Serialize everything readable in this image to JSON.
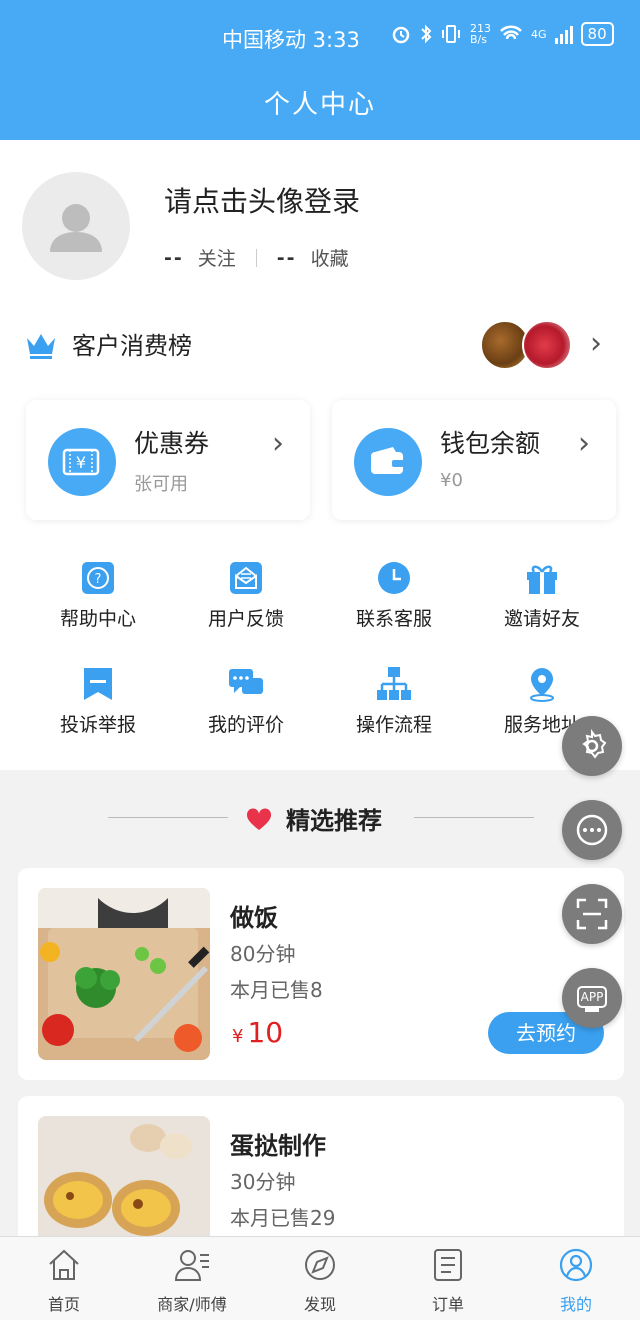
{
  "status_bar": {
    "carrier_time": "中国移动 3:33",
    "net_speed_top": "213",
    "net_speed_bottom": "B/s",
    "signal": "4G",
    "battery": "80"
  },
  "header": {
    "title": "个人中心"
  },
  "profile": {
    "login_prompt": "请点击头像登录",
    "follow_count": "--",
    "follow_label": "关注",
    "fav_count": "--",
    "fav_label": "收藏"
  },
  "ranking": {
    "label": "客户消费榜"
  },
  "cards": [
    {
      "title": "优惠券",
      "subtitle": "张可用",
      "icon": "coupon-icon"
    },
    {
      "title": "钱包余额",
      "subtitle": "¥0",
      "icon": "wallet-icon"
    }
  ],
  "menu": [
    {
      "label": "帮助中心",
      "icon": "help-icon"
    },
    {
      "label": "用户反馈",
      "icon": "feedback-icon"
    },
    {
      "label": "联系客服",
      "icon": "clock-icon"
    },
    {
      "label": "邀请好友",
      "icon": "gift-icon"
    },
    {
      "label": "投诉举报",
      "icon": "report-icon"
    },
    {
      "label": "我的评价",
      "icon": "chat-icon"
    },
    {
      "label": "操作流程",
      "icon": "flow-icon"
    },
    {
      "label": "服务地址",
      "icon": "location-icon"
    }
  ],
  "recommend": {
    "title": "精选推荐"
  },
  "products": [
    {
      "name": "做饭",
      "duration": "80分钟",
      "sold": "本月已售8",
      "currency": "¥",
      "price": "10",
      "button": "去预约"
    },
    {
      "name": "蛋挞制作",
      "duration": "30分钟",
      "sold": "本月已售29"
    }
  ],
  "floating": {
    "app_label": "APP"
  },
  "tabs": [
    {
      "label": "首页",
      "icon": "home-icon",
      "active": false
    },
    {
      "label": "商家/师傅",
      "icon": "merchant-icon",
      "active": false
    },
    {
      "label": "发现",
      "icon": "discover-icon",
      "active": false
    },
    {
      "label": "订单",
      "icon": "order-icon",
      "active": false
    },
    {
      "label": "我的",
      "icon": "profile-icon",
      "active": true
    }
  ],
  "colors": {
    "primary": "#48aaf4",
    "price": "#e02020",
    "heart": "#e8334a"
  }
}
